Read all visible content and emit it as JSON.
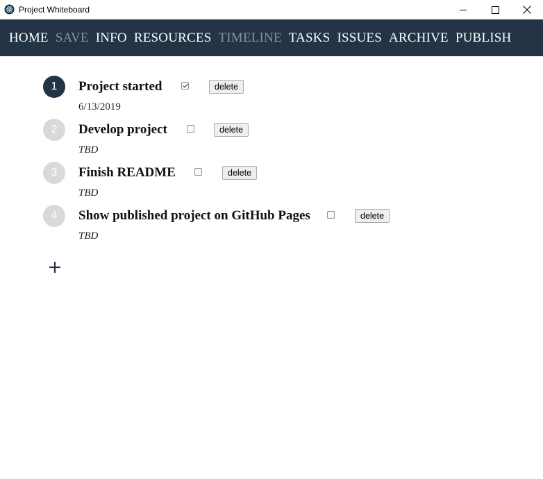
{
  "window": {
    "title": "Project Whiteboard",
    "icons": {
      "app": "electron-atom-icon",
      "minimize": "minimize-icon",
      "maximize": "maximize-icon",
      "close": "close-icon"
    }
  },
  "nav": {
    "items": [
      {
        "label": "HOME",
        "enabled": true
      },
      {
        "label": "SAVE",
        "enabled": false
      },
      {
        "label": "INFO",
        "enabled": true
      },
      {
        "label": "RESOURCES",
        "enabled": true
      },
      {
        "label": "TIMELINE",
        "enabled": false
      },
      {
        "label": "TASKS",
        "enabled": true
      },
      {
        "label": "ISSUES",
        "enabled": true
      },
      {
        "label": "ARCHIVE",
        "enabled": true
      },
      {
        "label": "PUBLISH",
        "enabled": true
      }
    ]
  },
  "timeline": {
    "milestones": [
      {
        "number": "1",
        "title": "Project started",
        "completed": true,
        "date": "6/13/2019",
        "delete_label": "delete"
      },
      {
        "number": "2",
        "title": "Develop project",
        "completed": false,
        "date": "TBD",
        "delete_label": "delete"
      },
      {
        "number": "3",
        "title": "Finish README",
        "completed": false,
        "date": "TBD",
        "delete_label": "delete"
      },
      {
        "number": "4",
        "title": "Show published project on GitHub Pages",
        "completed": false,
        "date": "TBD",
        "delete_label": "delete"
      }
    ],
    "add_icon": "plus-icon"
  },
  "colors": {
    "nav_bg": "#243447",
    "nav_text": "#ffffff",
    "nav_disabled": "#8a939d",
    "done_circle": "#243447",
    "todo_circle": "#d9d9d9"
  }
}
